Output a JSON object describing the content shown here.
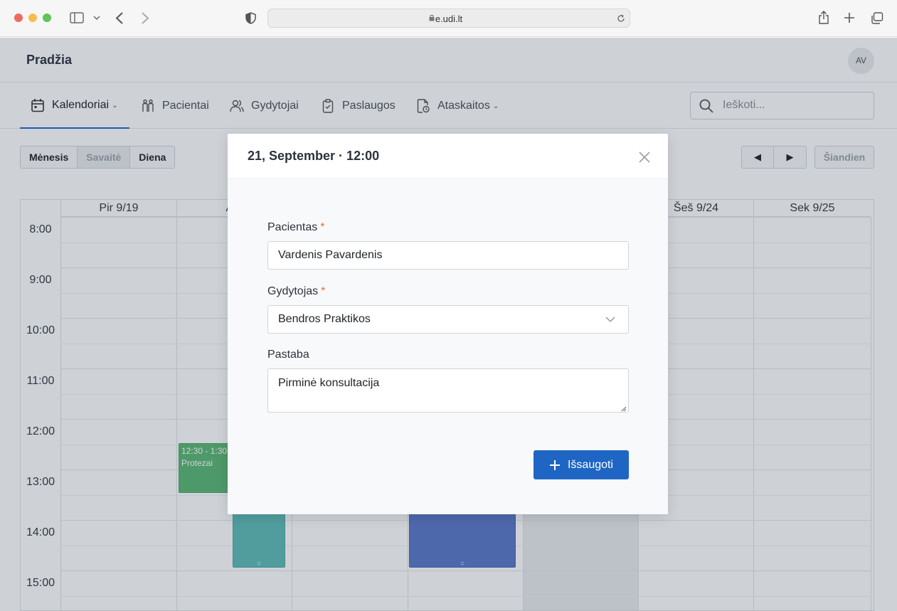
{
  "browser": {
    "url": "e.udi.lt"
  },
  "app": {
    "brand": "Pradžia",
    "avatar_initials": "AV"
  },
  "nav": {
    "items": [
      {
        "label": "Kalendoriai",
        "icon": "calendar-icon",
        "has_dropdown": true,
        "active": true
      },
      {
        "label": "Pacientai",
        "icon": "patients-icon",
        "has_dropdown": false,
        "active": false
      },
      {
        "label": "Gydytojai",
        "icon": "doctors-icon",
        "has_dropdown": false,
        "active": false
      },
      {
        "label": "Paslaugos",
        "icon": "clipboard-icon",
        "has_dropdown": false,
        "active": false
      },
      {
        "label": "Ataskaitos",
        "icon": "report-icon",
        "has_dropdown": true,
        "active": false
      }
    ],
    "search_placeholder": "Ieškoti..."
  },
  "toolbar": {
    "views": [
      "Mėnesis",
      "Savaitė",
      "Diena"
    ],
    "current_view": "Savaitė",
    "prev_label": "◀",
    "next_label": "▶",
    "today_label": "Šiandien"
  },
  "calendar": {
    "days": [
      "Pir 9/19",
      "Ant",
      "",
      "",
      "",
      "Šeš 9/24",
      "Sek 9/25"
    ],
    "times": [
      "8:00",
      "9:00",
      "10:00",
      "11:00",
      "12:00",
      "13:00",
      "14:00",
      "15:00"
    ],
    "events": [
      {
        "time": "12:30 - 1:30",
        "title": "Protezai",
        "color": "#5cb874"
      },
      {
        "time": "",
        "title": "",
        "color": "#5fbdb8"
      },
      {
        "time": "",
        "title": "",
        "color": "#5b79c9"
      }
    ],
    "drag_handle": "="
  },
  "modal": {
    "title": "21, September · 12:00",
    "patient": {
      "label": "Pacientas",
      "required_mark": "*",
      "value": "Vardenis Pavardenis"
    },
    "doctor": {
      "label": "Gydytojas",
      "required_mark": "*",
      "value": "Bendros Praktikos"
    },
    "note": {
      "label": "Pastaba",
      "value": "Pirminė konsultacija"
    },
    "save_label": "Išsaugoti"
  },
  "colors": {
    "primary": "#1f66c4",
    "required": "#e8702a",
    "event_green": "#5cb874",
    "event_teal": "#5fbdb8",
    "event_blue": "#5b79c9"
  }
}
